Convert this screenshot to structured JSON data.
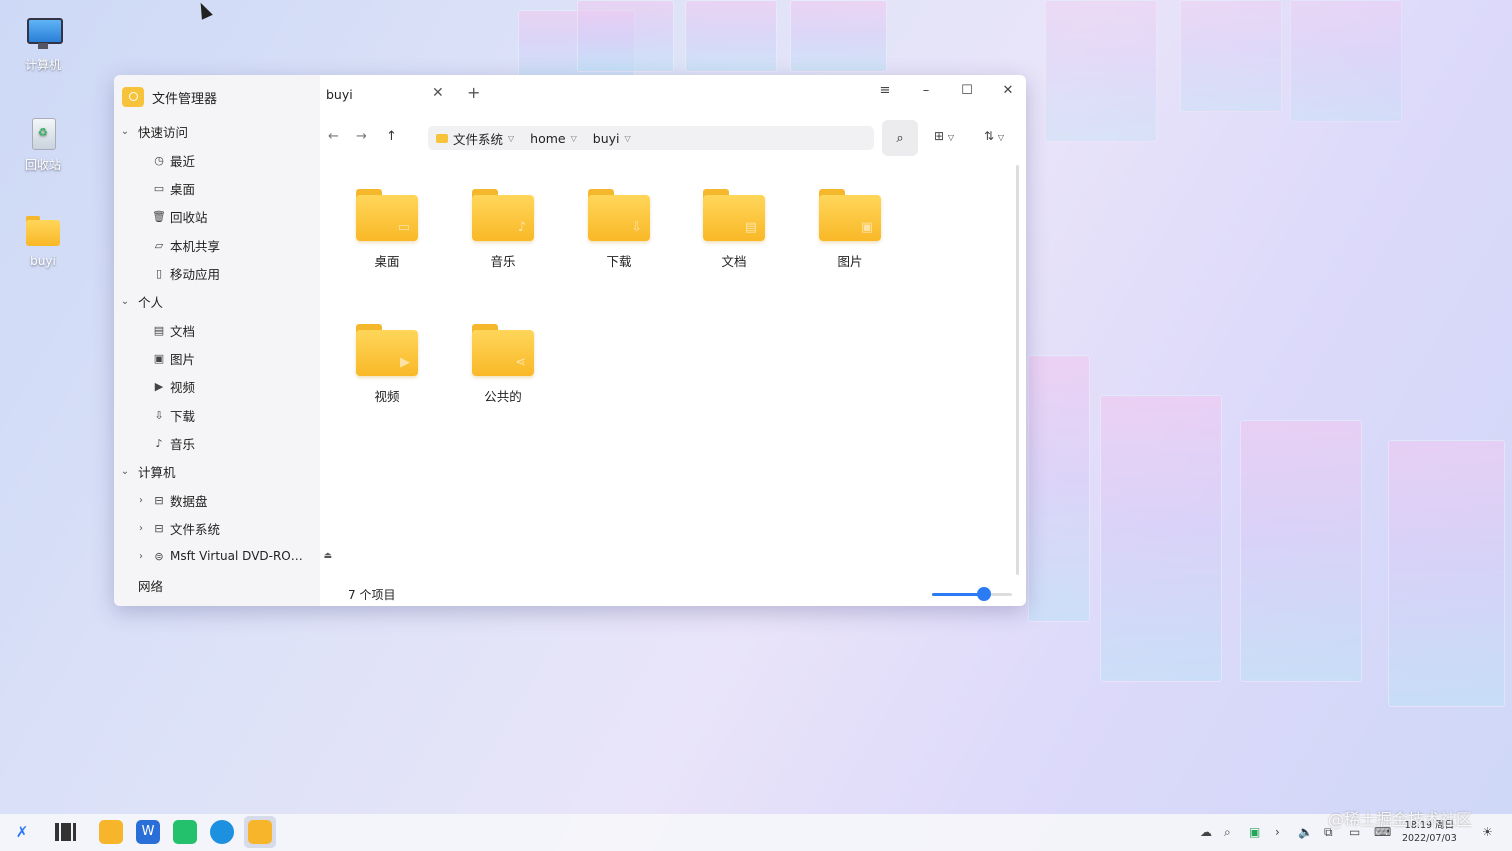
{
  "desktop": {
    "icons": [
      {
        "label": "计算机",
        "icon": "computer-icon"
      },
      {
        "label": "回收站",
        "icon": "trash-icon"
      },
      {
        "label": "buyi",
        "icon": "home-folder-icon"
      }
    ]
  },
  "window": {
    "app_title": "文件管理器",
    "tab_label": "buyi",
    "breadcrumbs": [
      "文件系统",
      "home",
      "buyi"
    ],
    "status_text": "7 个项目",
    "zoom_level": 0.65
  },
  "sidebar": {
    "groups": [
      {
        "label": "快速访问",
        "items": [
          {
            "label": "最近",
            "icon": "clock-icon"
          },
          {
            "label": "桌面",
            "icon": "desktop-icon"
          },
          {
            "label": "回收站",
            "icon": "trash-icon"
          },
          {
            "label": "本机共享",
            "icon": "share-folder-icon"
          },
          {
            "label": "移动应用",
            "icon": "phone-icon"
          }
        ]
      },
      {
        "label": "个人",
        "items": [
          {
            "label": "文档",
            "icon": "document-icon"
          },
          {
            "label": "图片",
            "icon": "image-icon"
          },
          {
            "label": "视频",
            "icon": "video-icon"
          },
          {
            "label": "下载",
            "icon": "download-icon"
          },
          {
            "label": "音乐",
            "icon": "music-icon"
          }
        ]
      },
      {
        "label": "计算机",
        "items": [
          {
            "label": "数据盘",
            "icon": "disk-icon"
          },
          {
            "label": "文件系统",
            "icon": "disk-icon"
          },
          {
            "label": "Msft Virtual DVD-RO…",
            "icon": "dvd-icon"
          }
        ]
      }
    ],
    "network_label": "网络"
  },
  "files": [
    {
      "name": "桌面",
      "icon": "desktop-folder-icon"
    },
    {
      "name": "音乐",
      "icon": "music-folder-icon"
    },
    {
      "name": "下载",
      "icon": "download-folder-icon"
    },
    {
      "name": "文档",
      "icon": "document-folder-icon"
    },
    {
      "name": "图片",
      "icon": "picture-folder-icon"
    },
    {
      "name": "视频",
      "icon": "video-folder-icon"
    },
    {
      "name": "公共的",
      "icon": "public-folder-icon"
    }
  ],
  "taskbar": {
    "clock_time": "18:19 周日",
    "clock_date": "2022/07/03"
  },
  "watermark": "@稀土掘金技术社区",
  "colors": {
    "accent": "#2a7bf4",
    "folder": "#f9b827"
  }
}
